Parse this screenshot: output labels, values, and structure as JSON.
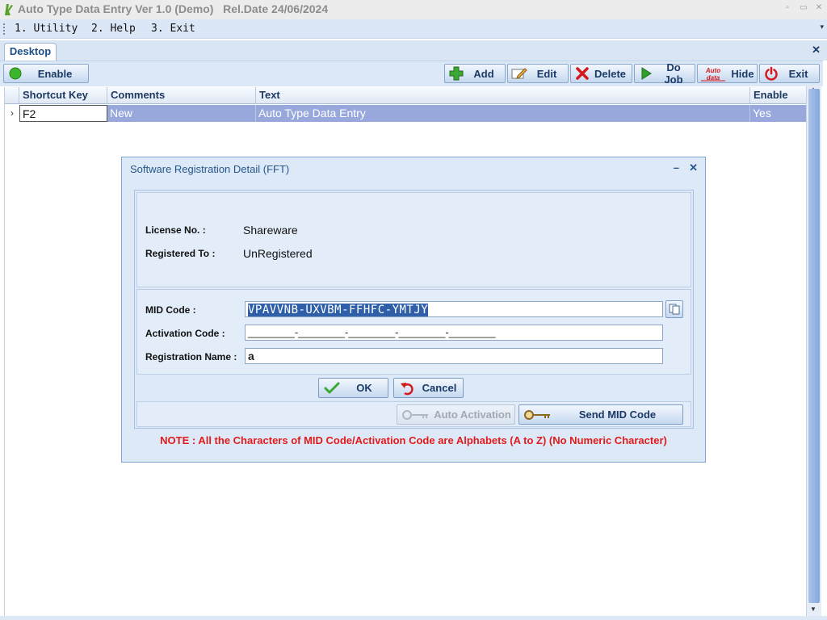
{
  "window": {
    "title": "Auto Type Data Entry Ver 1.0 (Demo)   Rel.Date 24/06/2024",
    "minimize_glyph": "▫",
    "restore_glyph": "▭",
    "close_glyph": "✕"
  },
  "menu": {
    "items": [
      {
        "label": "1. Utility"
      },
      {
        "label": "2. Help"
      },
      {
        "label": "3. Exit"
      }
    ],
    "overflow_glyph": "▾"
  },
  "tabs": {
    "active": "Desktop",
    "close_glyph": "✕"
  },
  "toolbar": {
    "enable_label": "Enable",
    "add_label": "Add",
    "edit_label": "Edit",
    "delete_label": "Delete",
    "dojob_label": "Do Job",
    "hide_label": "Hide",
    "exit_label": "Exit",
    "logo_text": "Auto data"
  },
  "grid": {
    "columns": [
      "Shortcut Key",
      "Comments",
      "Text",
      "Enable"
    ],
    "rows": [
      {
        "indicator": "›",
        "shortcut": "F2",
        "comments": "New",
        "text": "Auto Type Data Entry",
        "enable": "Yes"
      }
    ]
  },
  "dialog": {
    "title": "Software Registration Detail (FFT)",
    "minimize_glyph": "–",
    "close_glyph": "✕",
    "license_label": "License No. :",
    "license_value": "Shareware",
    "registered_label": "Registered To :",
    "registered_value": "UnRegistered",
    "mid_label": "MID Code :",
    "mid_value": "VPAVVNB-UXVBM-FFHFC-YMTJY",
    "activation_label": "Activation Code :",
    "activation_value": "________-________-________-________-________",
    "regname_label": "Registration Name :",
    "regname_value": "a",
    "ok_label": "OK",
    "cancel_label": "Cancel",
    "auto_activation_label": "Auto Activation",
    "send_mid_label": "Send MID Code",
    "note": "NOTE : All the Characters of MID Code/Activation Code are Alphabets (A to Z) (No Numeric Character)"
  },
  "colors": {
    "accent": "#1b3a66",
    "selection": "#98a8dc",
    "note": "#e11b1b",
    "highlight": "#2e5fa8"
  }
}
